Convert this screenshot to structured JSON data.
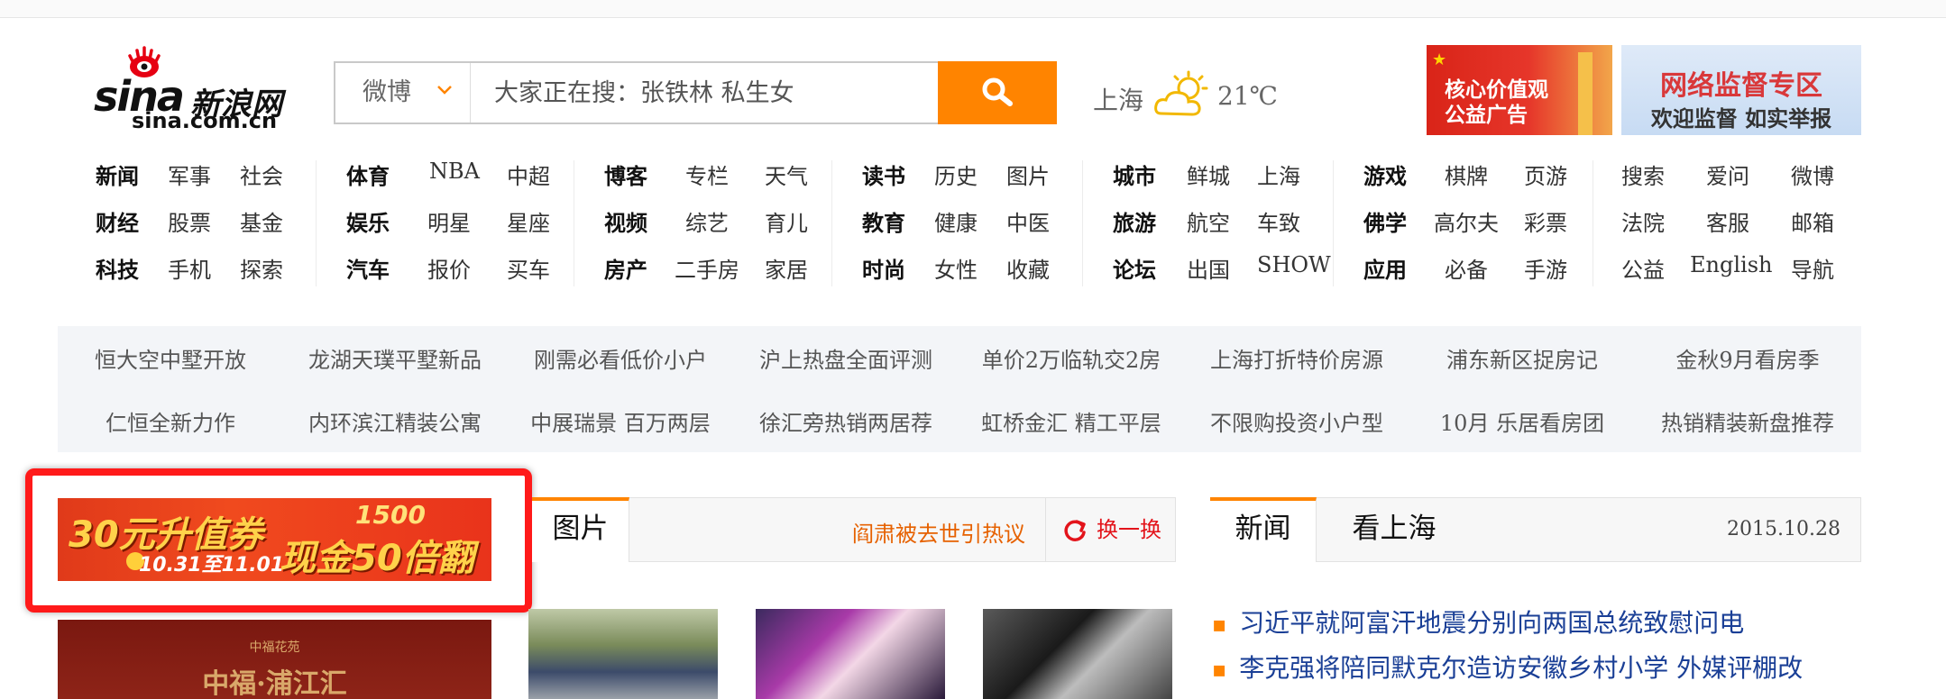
{
  "header": {
    "logo": {
      "main": "sina",
      "cn": "新浪网",
      "domain": "sina.com.cn"
    },
    "search": {
      "type": "微博",
      "placeholder": "大家正在搜：张铁林 私生女"
    },
    "weather": {
      "city": "上海",
      "temp": "21℃"
    },
    "ads": [
      {
        "text_line1": "核心价值观",
        "text_line2": "公益广告"
      },
      {
        "title": "网络监督专区",
        "subtitle": "欢迎监督 如实举报"
      }
    ]
  },
  "nav": [
    {
      "rows": [
        [
          "新闻",
          "军事",
          "社会"
        ],
        [
          "财经",
          "股票",
          "基金"
        ],
        [
          "科技",
          "手机",
          "探索"
        ]
      ]
    },
    {
      "rows": [
        [
          "体育",
          "NBA",
          "中超"
        ],
        [
          "娱乐",
          "明星",
          "星座"
        ],
        [
          "汽车",
          "报价",
          "买车"
        ]
      ]
    },
    {
      "rows": [
        [
          "博客",
          "专栏",
          "天气"
        ],
        [
          "视频",
          "综艺",
          "育儿"
        ],
        [
          "房产",
          "二手房",
          "家居"
        ]
      ]
    },
    {
      "rows": [
        [
          "读书",
          "历史",
          "图片"
        ],
        [
          "教育",
          "健康",
          "中医"
        ],
        [
          "时尚",
          "女性",
          "收藏"
        ]
      ]
    },
    {
      "rows": [
        [
          "城市",
          "鲜城",
          "上海"
        ],
        [
          "旅游",
          "航空",
          "车致"
        ],
        [
          "论坛",
          "出国",
          "SHOW"
        ]
      ]
    },
    {
      "rows": [
        [
          "游戏",
          "棋牌",
          "页游"
        ],
        [
          "佛学",
          "高尔夫",
          "彩票"
        ],
        [
          "应用",
          "必备",
          "手游"
        ]
      ]
    },
    {
      "rows": [
        [
          "搜索",
          "爱问",
          "微博"
        ],
        [
          "法院",
          "客服",
          "邮箱"
        ],
        [
          "公益",
          "English",
          "导航"
        ]
      ]
    }
  ],
  "property_links": [
    [
      "恒大空中墅开放",
      "龙湖天璞平墅新品",
      "刚需必看低价小户",
      "沪上热盘全面评测",
      "单价2万临轨交2房",
      "上海打折特价房源",
      "浦东新区捉房记",
      "金秋9月看房季"
    ],
    [
      "仁恒全新力作",
      "内环滨江精装公寓",
      "中展瑞景 百万两层",
      "徐汇旁热销两居荐",
      "虹桥金汇 精工平层",
      "不限购投资小户型",
      "10月 乐居看房团",
      "热销精装新盘推荐"
    ]
  ],
  "promo": {
    "big": "30元升值券",
    "date": "10.31至11.01",
    "cash": "现金50倍翻",
    "amount": "1500"
  },
  "estate_ad": {
    "small": "中福花苑",
    "name": "中福·浦江汇"
  },
  "pictures": {
    "tab": "图片",
    "headline": "阎肃被去世引热议",
    "refresh": "换一换"
  },
  "news": {
    "tab_active": "新闻",
    "tab_second": "看上海",
    "date": "2015.10.28",
    "items": [
      "习近平就阿富汗地震分别向两国总统致慰问电",
      "李克强将陪同默克尔造访安徽乡村小学 外媒评棚改"
    ]
  },
  "colors": {
    "accent": "#ff8400",
    "link_blue": "#1a3f96",
    "highlight_red": "#ff1a1a"
  }
}
